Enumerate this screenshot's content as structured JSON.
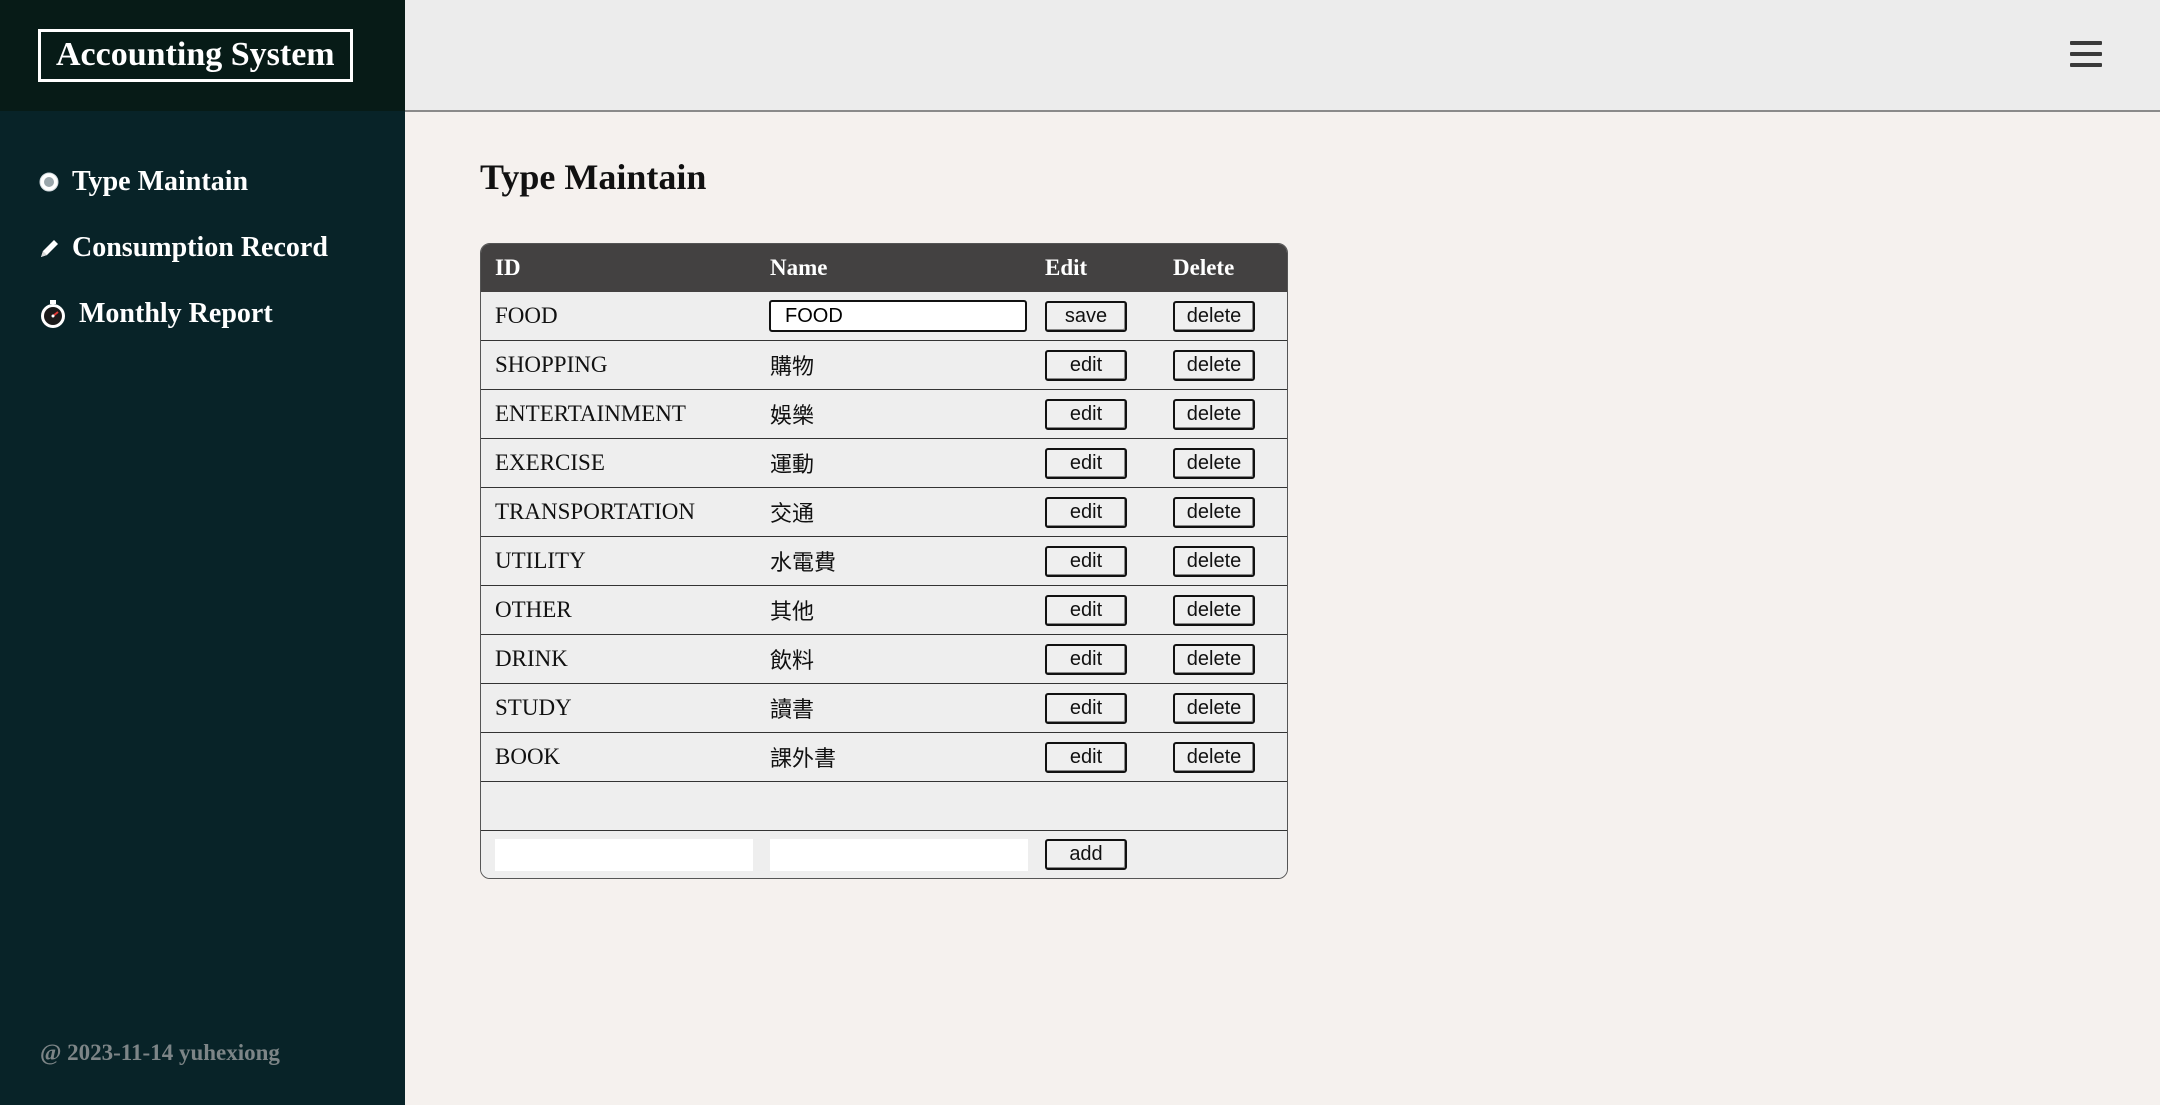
{
  "app": {
    "title": "Accounting System"
  },
  "sidebar": {
    "items": [
      {
        "label": "Type Maintain",
        "icon": "radio-dot-icon"
      },
      {
        "label": "Consumption Record",
        "icon": "pencil-icon"
      },
      {
        "label": "Monthly Report",
        "icon": "stopwatch-icon"
      }
    ],
    "footer": "@ 2023-11-14 yuhexiong"
  },
  "header": {
    "menu_icon": "hamburger-menu-icon"
  },
  "main": {
    "title": "Type Maintain",
    "columns": [
      "ID",
      "Name",
      "Edit",
      "Delete"
    ],
    "editing_row": {
      "id": "FOOD",
      "name_value": "FOOD",
      "save_label": "save",
      "delete_label": "delete"
    },
    "rows": [
      {
        "id": "SHOPPING",
        "name": "購物",
        "edit": "edit",
        "delete": "delete"
      },
      {
        "id": "ENTERTAINMENT",
        "name": "娛樂",
        "edit": "edit",
        "delete": "delete"
      },
      {
        "id": "EXERCISE",
        "name": "運動",
        "edit": "edit",
        "delete": "delete"
      },
      {
        "id": "TRANSPORTATION",
        "name": "交通",
        "edit": "edit",
        "delete": "delete"
      },
      {
        "id": "UTILITY",
        "name": "水電費",
        "edit": "edit",
        "delete": "delete"
      },
      {
        "id": "OTHER",
        "name": "其他",
        "edit": "edit",
        "delete": "delete"
      },
      {
        "id": "DRINK",
        "name": "飲料",
        "edit": "edit",
        "delete": "delete"
      },
      {
        "id": "STUDY",
        "name": "讀書",
        "edit": "edit",
        "delete": "delete"
      },
      {
        "id": "BOOK",
        "name": "課外書",
        "edit": "edit",
        "delete": "delete"
      }
    ],
    "add_row": {
      "id_value": "",
      "name_value": "",
      "add_label": "add"
    }
  },
  "colors": {
    "sidebar_bg": "#082328",
    "brand_bg": "#071b17",
    "header_bg": "#ececec",
    "main_bg": "#f5f1ee",
    "table_header_bg": "#434141",
    "row_bg": "#eeeeee"
  }
}
